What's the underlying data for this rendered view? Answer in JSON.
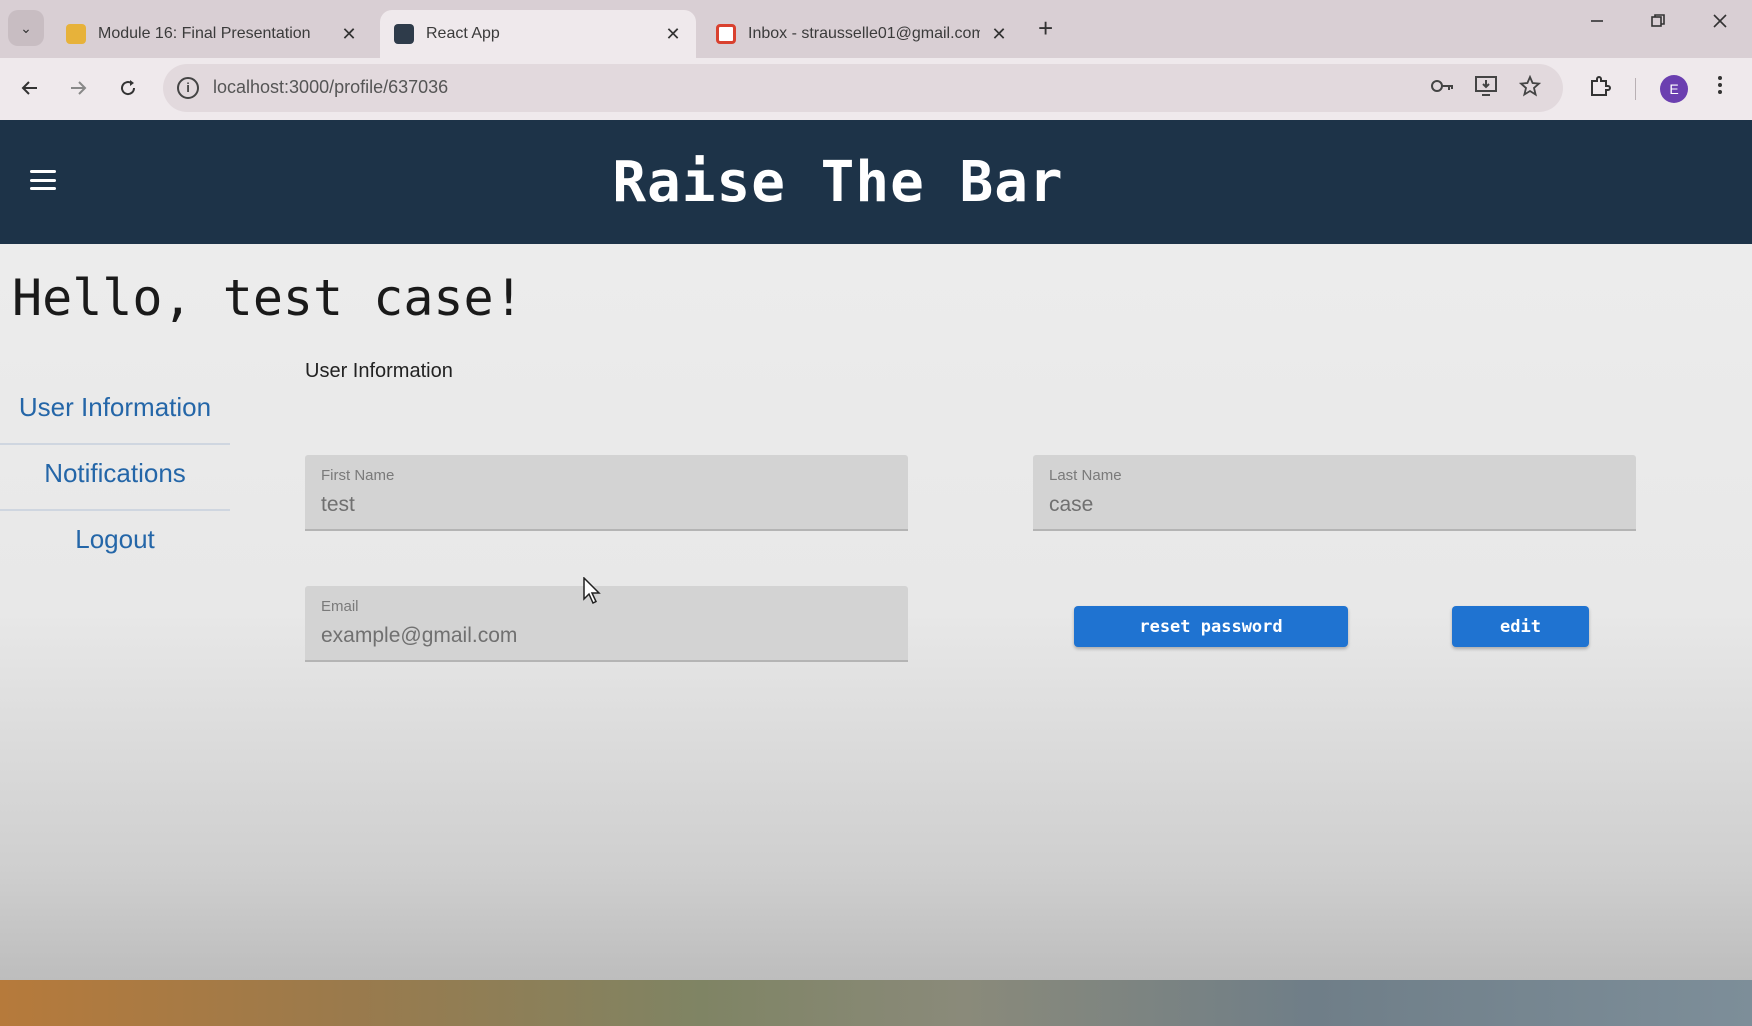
{
  "browser": {
    "tabs": [
      {
        "title": "Module 16: Final Presentation",
        "favicon_color": "#e7b23a",
        "active": false
      },
      {
        "title": "React App",
        "favicon_color": "#2e3b4a",
        "active": true
      },
      {
        "title": "Inbox - strausselle01@gmail.com",
        "favicon_color": "#d9412f",
        "active": false
      }
    ],
    "close_glyph": "✕",
    "new_tab_glyph": "+",
    "url": "localhost:3000/profile/637036",
    "profile_initial": "E"
  },
  "app": {
    "title": "Raise The Bar",
    "greeting": "Hello, test case!",
    "nav_items": [
      {
        "label": "User Information",
        "active": true
      },
      {
        "label": "Notifications",
        "active": false
      },
      {
        "label": "Logout",
        "active": false
      }
    ],
    "section_title": "User Information",
    "fields": {
      "first_name": {
        "label": "First Name",
        "value": "test"
      },
      "last_name": {
        "label": "Last Name",
        "value": "case"
      },
      "email": {
        "label": "Email",
        "value": "example@gmail.com"
      }
    },
    "buttons": {
      "reset_password": "reset password",
      "edit": "edit"
    },
    "colors": {
      "header_bg": "#1d3348",
      "accent": "#1f73d1",
      "nav_link": "#2466a8"
    }
  }
}
